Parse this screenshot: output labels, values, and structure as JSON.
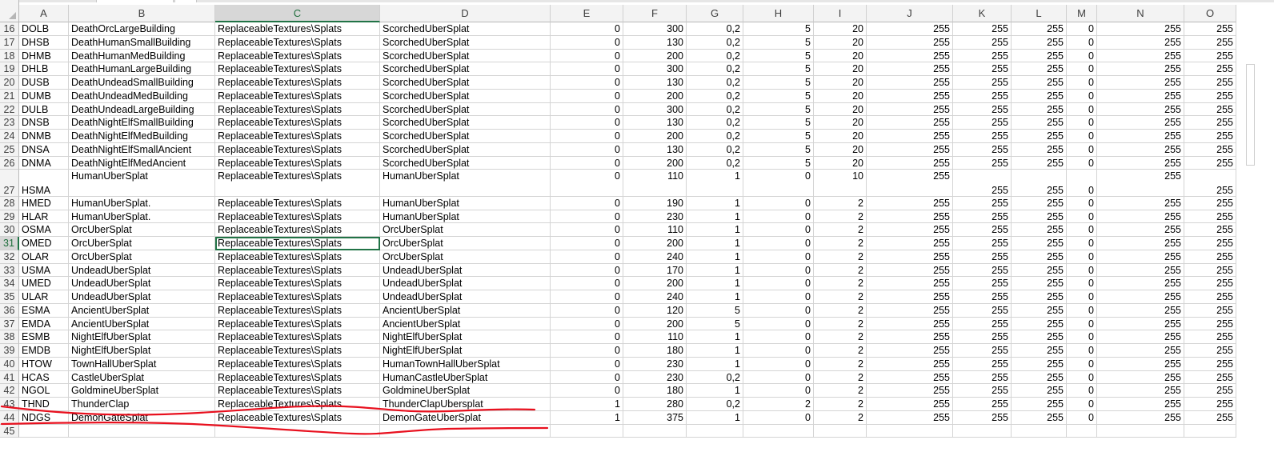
{
  "columns": [
    "A",
    "B",
    "C",
    "D",
    "E",
    "F",
    "G",
    "H",
    "I",
    "J",
    "K",
    "L",
    "M",
    "N",
    "O"
  ],
  "selected_column": "C",
  "selected_row": "31",
  "active_cell": {
    "row": "31",
    "column": "C"
  },
  "rows": [
    {
      "n": "16",
      "cells": [
        "DOLB",
        "DeathOrcLargeBuilding",
        "ReplaceableTextures\\Splats",
        "ScorchedUberSplat",
        "0",
        "300",
        "0,2",
        "5",
        "20",
        "255",
        "255",
        "255",
        "0",
        "255",
        "255"
      ]
    },
    {
      "n": "17",
      "cells": [
        "DHSB",
        "DeathHumanSmallBuilding",
        "ReplaceableTextures\\Splats",
        "ScorchedUberSplat",
        "0",
        "130",
        "0,2",
        "5",
        "20",
        "255",
        "255",
        "255",
        "0",
        "255",
        "255"
      ]
    },
    {
      "n": "18",
      "cells": [
        "DHMB",
        "DeathHumanMedBuilding",
        "ReplaceableTextures\\Splats",
        "ScorchedUberSplat",
        "0",
        "200",
        "0,2",
        "5",
        "20",
        "255",
        "255",
        "255",
        "0",
        "255",
        "255"
      ]
    },
    {
      "n": "19",
      "cells": [
        "DHLB",
        "DeathHumanLargeBuilding",
        "ReplaceableTextures\\Splats",
        "ScorchedUberSplat",
        "0",
        "300",
        "0,2",
        "5",
        "20",
        "255",
        "255",
        "255",
        "0",
        "255",
        "255"
      ]
    },
    {
      "n": "20",
      "cells": [
        "DUSB",
        "DeathUndeadSmallBuilding",
        "ReplaceableTextures\\Splats",
        "ScorchedUberSplat",
        "0",
        "130",
        "0,2",
        "5",
        "20",
        "255",
        "255",
        "255",
        "0",
        "255",
        "255"
      ]
    },
    {
      "n": "21",
      "cells": [
        "DUMB",
        "DeathUndeadMedBuilding",
        "ReplaceableTextures\\Splats",
        "ScorchedUberSplat",
        "0",
        "200",
        "0,2",
        "5",
        "20",
        "255",
        "255",
        "255",
        "0",
        "255",
        "255"
      ]
    },
    {
      "n": "22",
      "cells": [
        "DULB",
        "DeathUndeadLargeBuilding",
        "ReplaceableTextures\\Splats",
        "ScorchedUberSplat",
        "0",
        "300",
        "0,2",
        "5",
        "20",
        "255",
        "255",
        "255",
        "0",
        "255",
        "255"
      ]
    },
    {
      "n": "23",
      "cells": [
        "DNSB",
        "DeathNightElfSmallBuilding",
        "ReplaceableTextures\\Splats",
        "ScorchedUberSplat",
        "0",
        "130",
        "0,2",
        "5",
        "20",
        "255",
        "255",
        "255",
        "0",
        "255",
        "255"
      ]
    },
    {
      "n": "24",
      "cells": [
        "DNMB",
        "DeathNightElfMedBuilding",
        "ReplaceableTextures\\Splats",
        "ScorchedUberSplat",
        "0",
        "200",
        "0,2",
        "5",
        "20",
        "255",
        "255",
        "255",
        "0",
        "255",
        "255"
      ]
    },
    {
      "n": "25",
      "cells": [
        "DNSA",
        "DeathNightElfSmallAncient",
        "ReplaceableTextures\\Splats",
        "ScorchedUberSplat",
        "0",
        "130",
        "0,2",
        "5",
        "20",
        "255",
        "255",
        "255",
        "0",
        "255",
        "255"
      ]
    },
    {
      "n": "26",
      "cells": [
        "DNMA",
        "DeathNightElfMedAncient",
        "ReplaceableTextures\\Splats",
        "ScorchedUberSplat",
        "0",
        "200",
        "0,2",
        "5",
        "20",
        "255",
        "255",
        "255",
        "0",
        "255",
        "255"
      ]
    },
    {
      "n": "27",
      "tall": true,
      "cells": [
        "HSMA",
        "HumanUberSplat",
        "ReplaceableTextures\\Splats",
        "HumanUberSplat",
        "0",
        "110",
        "1",
        "0",
        "10",
        "255",
        "255",
        "255",
        "0",
        "255",
        "255"
      ]
    },
    {
      "n": "28",
      "cells": [
        "HMED",
        "HumanUberSplat.",
        "ReplaceableTextures\\Splats",
        "HumanUberSplat",
        "0",
        "190",
        "1",
        "0",
        "2",
        "255",
        "255",
        "255",
        "0",
        "255",
        "255"
      ]
    },
    {
      "n": "29",
      "cells": [
        "HLAR",
        "HumanUberSplat.",
        "ReplaceableTextures\\Splats",
        "HumanUberSplat",
        "0",
        "230",
        "1",
        "0",
        "2",
        "255",
        "255",
        "255",
        "0",
        "255",
        "255"
      ]
    },
    {
      "n": "30",
      "cells": [
        "OSMA",
        "OrcUberSplat",
        "ReplaceableTextures\\Splats",
        "OrcUberSplat",
        "0",
        "110",
        "1",
        "0",
        "2",
        "255",
        "255",
        "255",
        "0",
        "255",
        "255"
      ]
    },
    {
      "n": "31",
      "cells": [
        "OMED",
        "OrcUberSplat",
        "ReplaceableTextures\\Splats",
        "OrcUberSplat",
        "0",
        "200",
        "1",
        "0",
        "2",
        "255",
        "255",
        "255",
        "0",
        "255",
        "255"
      ]
    },
    {
      "n": "32",
      "cells": [
        "OLAR",
        "OrcUberSplat",
        "ReplaceableTextures\\Splats",
        "OrcUberSplat",
        "0",
        "240",
        "1",
        "0",
        "2",
        "255",
        "255",
        "255",
        "0",
        "255",
        "255"
      ]
    },
    {
      "n": "33",
      "cells": [
        "USMA",
        "UndeadUberSplat",
        "ReplaceableTextures\\Splats",
        "UndeadUberSplat",
        "0",
        "170",
        "1",
        "0",
        "2",
        "255",
        "255",
        "255",
        "0",
        "255",
        "255"
      ]
    },
    {
      "n": "34",
      "cells": [
        "UMED",
        "UndeadUberSplat",
        "ReplaceableTextures\\Splats",
        "UndeadUberSplat",
        "0",
        "200",
        "1",
        "0",
        "2",
        "255",
        "255",
        "255",
        "0",
        "255",
        "255"
      ]
    },
    {
      "n": "35",
      "cells": [
        "ULAR",
        "UndeadUberSplat",
        "ReplaceableTextures\\Splats",
        "UndeadUberSplat",
        "0",
        "240",
        "1",
        "0",
        "2",
        "255",
        "255",
        "255",
        "0",
        "255",
        "255"
      ]
    },
    {
      "n": "36",
      "cells": [
        "ESMA",
        "AncientUberSplat",
        "ReplaceableTextures\\Splats",
        "AncientUberSplat",
        "0",
        "120",
        "5",
        "0",
        "2",
        "255",
        "255",
        "255",
        "0",
        "255",
        "255"
      ]
    },
    {
      "n": "37",
      "cells": [
        "EMDA",
        "AncientUberSplat",
        "ReplaceableTextures\\Splats",
        "AncientUberSplat",
        "0",
        "200",
        "5",
        "0",
        "2",
        "255",
        "255",
        "255",
        "0",
        "255",
        "255"
      ]
    },
    {
      "n": "38",
      "cells": [
        "ESMB",
        "NightElfUberSplat",
        "ReplaceableTextures\\Splats",
        "NightElfUberSplat",
        "0",
        "110",
        "1",
        "0",
        "2",
        "255",
        "255",
        "255",
        "0",
        "255",
        "255"
      ]
    },
    {
      "n": "39",
      "cells": [
        "EMDB",
        "NightElfUberSplat",
        "ReplaceableTextures\\Splats",
        "NightElfUberSplat",
        "0",
        "180",
        "1",
        "0",
        "2",
        "255",
        "255",
        "255",
        "0",
        "255",
        "255"
      ]
    },
    {
      "n": "40",
      "cells": [
        "HTOW",
        "TownHallUberSplat",
        "ReplaceableTextures\\Splats",
        "HumanTownHallUberSplat",
        "0",
        "230",
        "1",
        "0",
        "2",
        "255",
        "255",
        "255",
        "0",
        "255",
        "255"
      ]
    },
    {
      "n": "41",
      "cells": [
        "HCAS",
        "CastleUberSplat",
        "ReplaceableTextures\\Splats",
        "HumanCastleUberSplat",
        "0",
        "230",
        "0,2",
        "0",
        "2",
        "255",
        "255",
        "255",
        "0",
        "255",
        "255"
      ]
    },
    {
      "n": "42",
      "cells": [
        "NGOL",
        "GoldmineUberSplat",
        "ReplaceableTextures\\Splats",
        "GoldmineUberSplat",
        "0",
        "180",
        "1",
        "0",
        "2",
        "255",
        "255",
        "255",
        "0",
        "255",
        "255"
      ]
    },
    {
      "n": "43",
      "cells": [
        "THND",
        "ThunderClap",
        "ReplaceableTextures\\Splats",
        "ThunderClapUbersplat",
        "1",
        "280",
        "0,2",
        "2",
        "2",
        "255",
        "255",
        "255",
        "0",
        "255",
        "255"
      ]
    },
    {
      "n": "44",
      "cells": [
        "NDGS",
        "DemonGateSplat",
        "ReplaceableTextures\\Splats",
        "DemonGateUberSplat",
        "1",
        "375",
        "1",
        "0",
        "2",
        "255",
        "255",
        "255",
        "0",
        "255",
        "255"
      ]
    },
    {
      "n": "45",
      "cells": [
        "",
        "",
        "",
        "",
        "",
        "",
        "",
        "",
        "",
        "",
        "",
        "",
        "",
        "",
        ""
      ]
    }
  ],
  "annotation_color": "#e8101e"
}
